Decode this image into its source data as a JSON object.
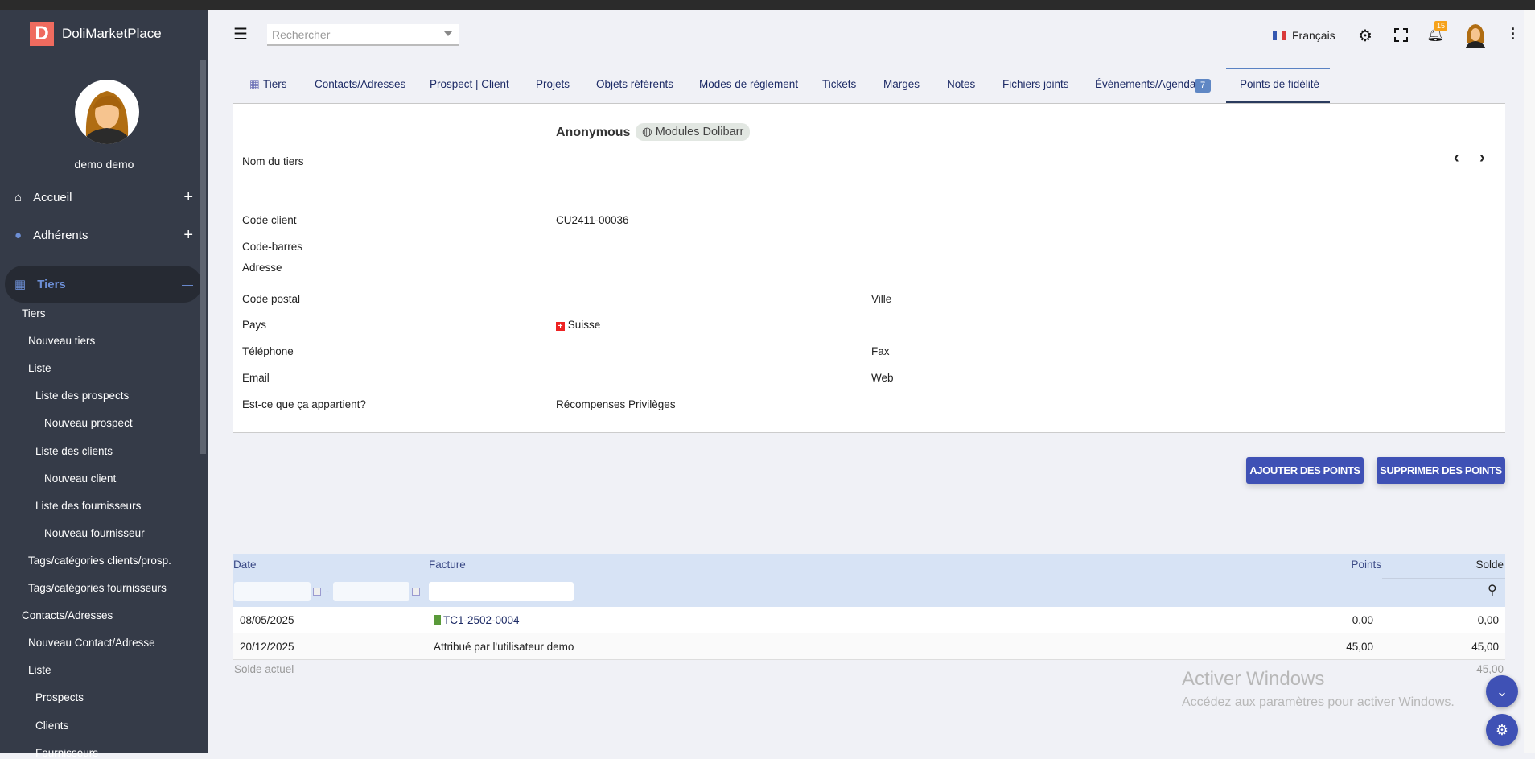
{
  "app": {
    "logo_letter": "D",
    "name": "DoliMarketPlace"
  },
  "user": {
    "name": "demo demo"
  },
  "sidebar": {
    "main": [
      {
        "label": "Accueil",
        "toggle": "+"
      },
      {
        "label": "Adhérents",
        "toggle": "+"
      },
      {
        "label": "Tiers",
        "toggle": "—"
      }
    ],
    "sub": [
      {
        "label": "Tiers",
        "level": 0
      },
      {
        "label": "Nouveau tiers",
        "level": 1
      },
      {
        "label": "Liste",
        "level": 1
      },
      {
        "label": "Liste des prospects",
        "level": 2
      },
      {
        "label": "Nouveau prospect",
        "level": 3
      },
      {
        "label": "Liste des clients",
        "level": 2
      },
      {
        "label": "Nouveau client",
        "level": 3
      },
      {
        "label": "Liste des fournisseurs",
        "level": 2
      },
      {
        "label": "Nouveau fournisseur",
        "level": 3
      },
      {
        "label": "Tags/catégories clients/prosp.",
        "level": 1
      },
      {
        "label": "Tags/catégories fournisseurs",
        "level": 1
      },
      {
        "label": "Contacts/Adresses",
        "level": 0
      },
      {
        "label": "Nouveau Contact/Adresse",
        "level": 1
      },
      {
        "label": "Liste",
        "level": 1
      },
      {
        "label": "Prospects",
        "level": 2
      },
      {
        "label": "Clients",
        "level": 2
      },
      {
        "label": "Fournisseurs",
        "level": 2
      }
    ]
  },
  "header": {
    "search_placeholder": "Rechercher",
    "language": "Français",
    "notifications": "15"
  },
  "tabs": [
    "Tiers",
    "Contacts/Adresses",
    "Prospect | Client",
    "Projets",
    "Objets référents",
    "Modes de règlement",
    "Tickets",
    "Marges",
    "Notes",
    "Fichiers joints",
    "Événements/Agenda",
    "Points de fidélité"
  ],
  "tab_badge": "7",
  "third_party": {
    "name": "Anonymous",
    "tag": "Modules Dolibarr",
    "labels": {
      "name": "Nom du tiers",
      "code_client": "Code client",
      "barcode": "Code-barres",
      "address": "Adresse",
      "zip": "Code postal",
      "town": "Ville",
      "country": "Pays",
      "phone": "Téléphone",
      "fax": "Fax",
      "email": "Email",
      "web": "Web",
      "belongs": "Est-ce que ça appartient?"
    },
    "values": {
      "code_client": "CU2411-00036",
      "country": "Suisse",
      "belongs": "Récompenses Privilèges"
    }
  },
  "actions": {
    "add": "AJOUTER DES POINTS",
    "remove": "SUPPRIMER DES POINTS"
  },
  "table": {
    "headers": {
      "date": "Date",
      "invoice": "Facture",
      "points": "Points",
      "balance": "Solde"
    },
    "date_sep": "-",
    "rows": [
      {
        "date": "08/05/2025",
        "invoice": "TC1-2502-0004",
        "points": "0,00",
        "balance": "0,00"
      },
      {
        "date": "20/12/2025",
        "invoice": "Attribué par l'utilisateur demo",
        "points": "45,00",
        "balance": "45,00"
      }
    ],
    "footer_label": "Solde actuel",
    "footer_value": "45,00"
  },
  "watermark": {
    "title": "Activer Windows",
    "subtitle": "Accédez aux paramètres pour activer Windows."
  },
  "colors": {
    "accent": "#3f51b5",
    "sidebar": "#353b48",
    "table_header": "#d7e3f5"
  }
}
